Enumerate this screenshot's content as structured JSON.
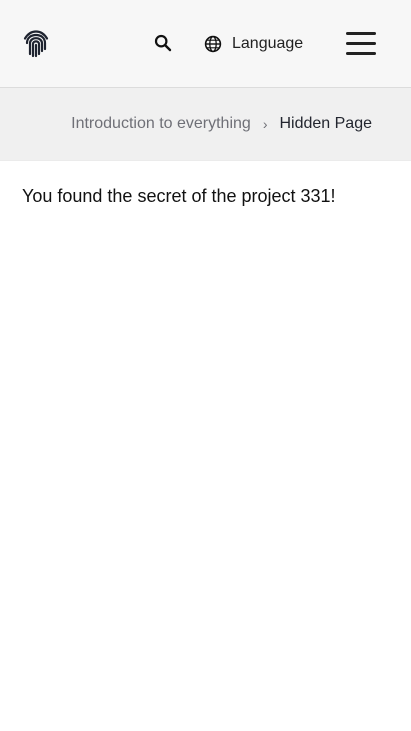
{
  "header": {
    "logo_icon": "fingerprint-icon",
    "search_icon": "search-icon",
    "language_icon": "globe-icon",
    "language_label": "Language",
    "menu_icon": "hamburger-menu-icon"
  },
  "breadcrumb": {
    "items": [
      {
        "label": "Introduction to everything"
      },
      {
        "label": "Hidden Page"
      }
    ],
    "separator": "›"
  },
  "main": {
    "message": "You found the secret of the project 331!"
  },
  "colors": {
    "header_background": "#f7f7f7",
    "breadcrumb_background": "#f0f0f0",
    "text_primary": "#111111",
    "text_muted": "#6f7077"
  }
}
